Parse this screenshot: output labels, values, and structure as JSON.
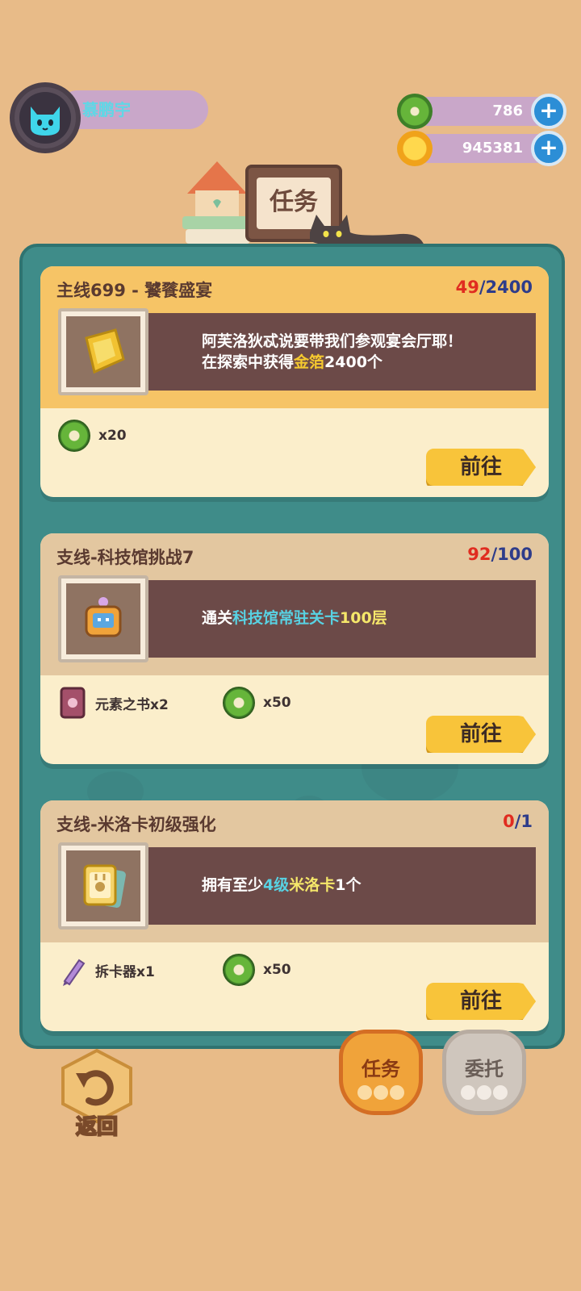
{
  "player": {
    "name": "慕鹏宇"
  },
  "resources": {
    "gems": "786",
    "coins": "945381"
  },
  "header": {
    "title": "任务"
  },
  "tasks": [
    {
      "type": "main",
      "title": "主线699 - 饕餮盛宴",
      "progress_current": "49",
      "progress_total": "2400",
      "desc_line1": "阿芙洛狄忒说要带我们参观宴会厅耶！",
      "desc_line2_prefix": "在探索中获得",
      "desc_line2_highlight": "金箔",
      "desc_line2_suffix": "2400个",
      "rewards": [
        {
          "icon": "donut-icon",
          "label": "x20"
        }
      ],
      "button": "前往"
    },
    {
      "type": "side",
      "title": "支线-科技馆挑战7",
      "progress_current": "92",
      "progress_total": "100",
      "desc_prefix": "通关",
      "desc_highlight1": "科技馆常驻关卡",
      "desc_highlight2": "100层",
      "rewards": [
        {
          "icon": "book-icon",
          "label": "元素之书x2"
        },
        {
          "icon": "donut-icon",
          "label": "x50"
        }
      ],
      "button": "前往"
    },
    {
      "type": "side",
      "title": "支线-米洛卡初级强化",
      "progress_current": "0",
      "progress_total": "1",
      "desc_prefix": "拥有至少",
      "desc_highlight1": "4级",
      "desc_highlight2": "米洛卡",
      "desc_suffix": "1个",
      "rewards": [
        {
          "icon": "pen-icon",
          "label": "拆卡器x1"
        },
        {
          "icon": "donut-icon",
          "label": "x50"
        }
      ],
      "button": "前往"
    }
  ],
  "bottom": {
    "back_label": "返回",
    "tab_task": "任务",
    "tab_commission": "委托"
  },
  "colors": {
    "background": "#e8bb88",
    "panel": "#3f8c89",
    "main_card_header": "#f6c466",
    "side_card_header": "#e3c7a0",
    "go_button": "#f8c43a"
  }
}
